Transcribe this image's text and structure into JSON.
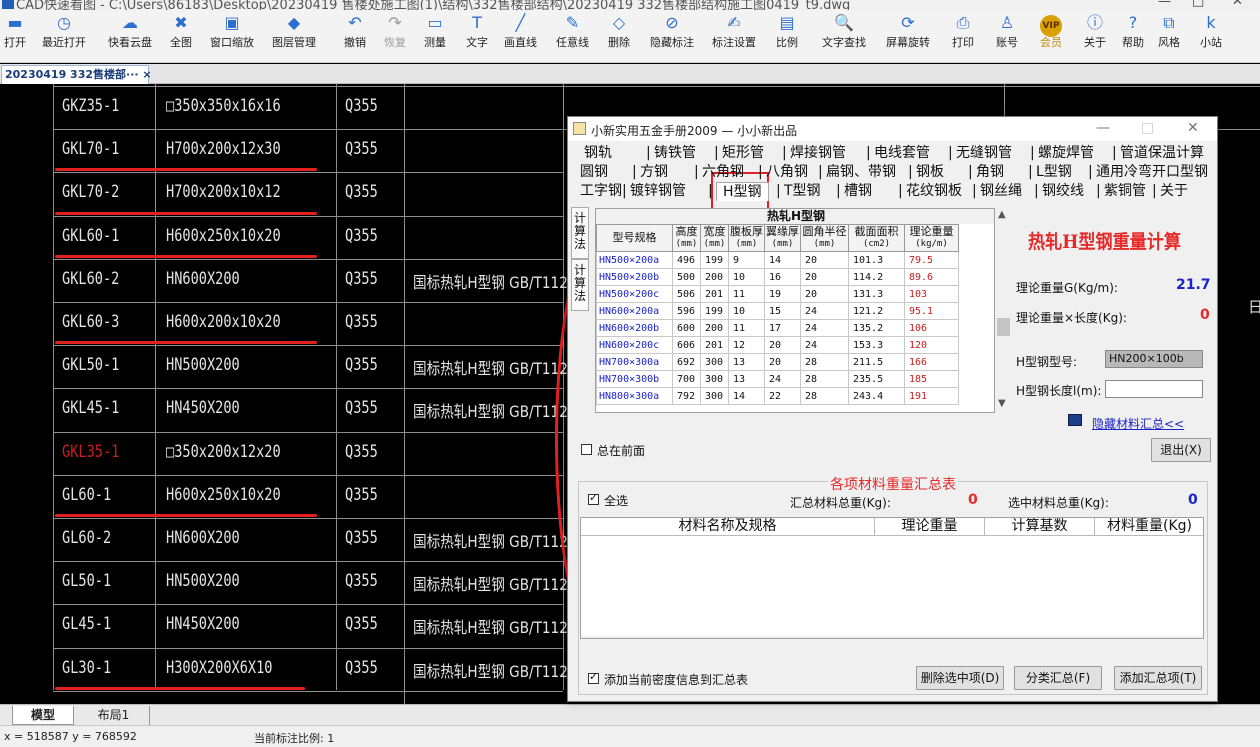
{
  "window": {
    "title": "CAD快速看图 - C:\\Users\\86183\\Desktop\\20230419 售楼处施工图(1)\\结构\\332售楼部结构\\20230419 332售楼部结构施工图0419_t9.dwg",
    "controls": [
      "—",
      "□",
      "✕"
    ]
  },
  "toolbar": [
    {
      "label": "打开",
      "icon": "folder-icon",
      "glyph": "▬",
      "dim": false
    },
    {
      "label": "最近打开",
      "icon": "recent-icon",
      "glyph": "◷",
      "dim": false
    },
    {
      "label": "快看云盘",
      "icon": "cloud-icon",
      "glyph": "☁",
      "dim": false
    },
    {
      "label": "全图",
      "icon": "fullview-icon",
      "glyph": "✖",
      "dim": false
    },
    {
      "label": "窗口缩放",
      "icon": "window-zoom-icon",
      "glyph": "▣",
      "dim": false
    },
    {
      "label": "图层管理",
      "icon": "layers-icon",
      "glyph": "◆",
      "dim": false
    },
    {
      "label": "撤销",
      "icon": "undo-icon",
      "glyph": "↶",
      "dim": false
    },
    {
      "label": "恢复",
      "icon": "redo-icon",
      "glyph": "↷",
      "dim": true
    },
    {
      "label": "测量",
      "icon": "measure-icon",
      "glyph": "▭",
      "dim": false
    },
    {
      "label": "文字",
      "icon": "text-icon",
      "glyph": "T",
      "dim": false
    },
    {
      "label": "画直线",
      "icon": "line-icon",
      "glyph": "╱",
      "dim": false
    },
    {
      "label": "任意线",
      "icon": "freeline-icon",
      "glyph": "✎",
      "dim": false
    },
    {
      "label": "删除",
      "icon": "eraser-icon",
      "glyph": "◇",
      "dim": false
    },
    {
      "label": "隐藏标注",
      "icon": "hide-mark-icon",
      "glyph": "⊘",
      "dim": false
    },
    {
      "label": "标注设置",
      "icon": "mark-settings-icon",
      "glyph": "✍",
      "dim": false
    },
    {
      "label": "比例",
      "icon": "scale-icon",
      "glyph": "▤",
      "dim": false
    },
    {
      "label": "文字查找",
      "icon": "text-search-icon",
      "glyph": "🔍",
      "dim": false
    },
    {
      "label": "屏幕旋转",
      "icon": "rotate-icon",
      "glyph": "⟳",
      "dim": false
    },
    {
      "label": "打印",
      "icon": "print-icon",
      "glyph": "⎙",
      "dim": false
    },
    {
      "label": "账号",
      "icon": "account-icon",
      "glyph": "♙",
      "dim": false
    },
    {
      "label": "会员",
      "icon": "vip-icon",
      "glyph": "VIP",
      "dim": false
    },
    {
      "label": "关于",
      "icon": "info-icon",
      "glyph": "ⓘ",
      "dim": false
    },
    {
      "label": "帮助",
      "icon": "help-icon",
      "glyph": "?",
      "dim": false
    },
    {
      "label": "风格",
      "icon": "style-icon",
      "glyph": "⧉",
      "dim": false
    },
    {
      "label": "小站",
      "icon": "site-icon",
      "glyph": "k",
      "dim": false
    }
  ],
  "doc_tab": {
    "label": "20230419 332售楼部··· ×"
  },
  "drawing_rows": [
    {
      "code": "GKZ35-1",
      "spec": "□350x350x16x16",
      "grade": "Q355",
      "std": ""
    },
    {
      "code": "GKL70-1",
      "spec": "H700x200x12x30",
      "grade": "Q355",
      "std": ""
    },
    {
      "code": "GKL70-2",
      "spec": "H700x200x10x12",
      "grade": "Q355",
      "std": ""
    },
    {
      "code": "GKL60-1",
      "spec": "H600x250x10x20",
      "grade": "Q355",
      "std": ""
    },
    {
      "code": "GKL60-2",
      "spec": "HN600X200",
      "grade": "Q355",
      "std": "国标热轧H型钢 GB/T112"
    },
    {
      "code": "GKL60-3",
      "spec": "H600x200x10x20",
      "grade": "Q355",
      "std": ""
    },
    {
      "code": "GKL50-1",
      "spec": "HN500X200",
      "grade": "Q355",
      "std": "国标热轧H型钢 GB/T112"
    },
    {
      "code": "GKL45-1",
      "spec": "HN450X200",
      "grade": "Q355",
      "std": "国标热轧H型钢 GB/T112"
    },
    {
      "code": "GKL35-1",
      "spec": "□350x200x12x20",
      "grade": "Q355",
      "std": ""
    },
    {
      "code": "GL60-1",
      "spec": "H600x250x10x20",
      "grade": "Q355",
      "std": ""
    },
    {
      "code": "GL60-2",
      "spec": "HN600X200",
      "grade": "Q355",
      "std": "国标热轧H型钢 GB/T112"
    },
    {
      "code": "GL50-1",
      "spec": "HN500X200",
      "grade": "Q355",
      "std": "国标热轧H型钢 GB/T112"
    },
    {
      "code": "GL45-1",
      "spec": "HN450X200",
      "grade": "Q355",
      "std": "国标热轧H型钢 GB/T112"
    },
    {
      "code": "GL30-1",
      "spec": "H300X200X6X10",
      "grade": "Q355",
      "std": "国标热轧H型钢 GB/T112"
    }
  ],
  "drawing_side_glyph": "日",
  "model_tabs": [
    "模型",
    "布局1"
  ],
  "status": {
    "coords": "x = 518587  y = 768592",
    "scale": "当前标注比例: 1"
  },
  "dialog": {
    "title": "小新实用五金手册2009 — 小小新出品",
    "controls": [
      "—",
      "□",
      "✕"
    ],
    "tab_rows": [
      [
        "钢轨",
        "铸铁管",
        "矩形管",
        "焊接钢管",
        "电线套管",
        "无缝钢管",
        "螺旋焊管",
        "管道保温计算"
      ],
      [
        "圆钢",
        "方钢",
        "六角钢",
        "八角钢",
        "扁钢、带钢",
        "钢板",
        "角钢",
        "L型钢",
        "通用冷弯开口型钢"
      ],
      [
        "工字钢",
        "镀锌钢管",
        "H型钢",
        "T型钢",
        "槽钢",
        "花纹钢板",
        "钢丝绳",
        "钢绞线",
        "紫铜管",
        "关于"
      ]
    ],
    "selected_tab": "H型钢",
    "side_tabs": [
      "计算法",
      "计算法"
    ],
    "grid_caption": "热轧H型钢",
    "grid_headers": [
      {
        "t": "型号规格",
        "u": ""
      },
      {
        "t": "高度",
        "u": "(mm)"
      },
      {
        "t": "宽度",
        "u": "(mm)"
      },
      {
        "t": "腹板厚",
        "u": "(mm)"
      },
      {
        "t": "翼缘厚",
        "u": "(mm)"
      },
      {
        "t": "圆角半径",
        "u": "(mm)"
      },
      {
        "t": "截面面积",
        "u": "(cm2)"
      },
      {
        "t": "理论重量",
        "u": "(kg/m)"
      }
    ],
    "grid_rows": [
      [
        "HN500×200a",
        "496",
        "199",
        "9",
        "14",
        "20",
        "101.3",
        "79.5"
      ],
      [
        "HN500×200b",
        "500",
        "200",
        "10",
        "16",
        "20",
        "114.2",
        "89.6"
      ],
      [
        "HN500×200c",
        "506",
        "201",
        "11",
        "19",
        "20",
        "131.3",
        "103"
      ],
      [
        "HN600×200a",
        "596",
        "199",
        "10",
        "15",
        "24",
        "121.2",
        "95.1"
      ],
      [
        "HN600×200b",
        "600",
        "200",
        "11",
        "17",
        "24",
        "135.2",
        "106"
      ],
      [
        "HN600×200c",
        "606",
        "201",
        "12",
        "20",
        "24",
        "153.3",
        "120"
      ],
      [
        "HN700×300a",
        "692",
        "300",
        "13",
        "20",
        "28",
        "211.5",
        "166"
      ],
      [
        "HN700×300b",
        "700",
        "300",
        "13",
        "24",
        "28",
        "235.5",
        "185"
      ],
      [
        "HN800×300a",
        "792",
        "300",
        "14",
        "22",
        "28",
        "243.4",
        "191"
      ]
    ],
    "calc_title": "热轧H型钢重量计算",
    "weight_label": "理论重量G(Kg/m):",
    "weight_value": "21.7",
    "total_label": "理论重量×长度(Kg):",
    "total_value": "0",
    "model_label": "H型钢型号:",
    "model_value": "HN200×100b",
    "length_label": "H型钢长度l(m):",
    "length_value": "",
    "hide_link": "隐藏材料汇总<<",
    "always_on_top": "总在前面",
    "exit": "退出(X)",
    "summary_title": "各项材料重量汇总表",
    "select_all": "全选",
    "sum_total_label": "汇总材料总重(Kg):",
    "sum_total_value": "0",
    "sel_total_label": "选中材料总重(Kg):",
    "sel_total_value": "0",
    "list_headers": [
      "材料名称及规格",
      "理论重量",
      "计算基数",
      "材料重量(Kg)"
    ],
    "add_density": "添加当前密度信息到汇总表",
    "btn_delete": "删除选中项(D)",
    "btn_classify": "分类汇总(F)",
    "btn_add": "添加汇总项(T)"
  },
  "colors": {
    "accent_red": "#e32020",
    "value_blue": "#1a24c8",
    "value_red": "#c81e1e"
  }
}
